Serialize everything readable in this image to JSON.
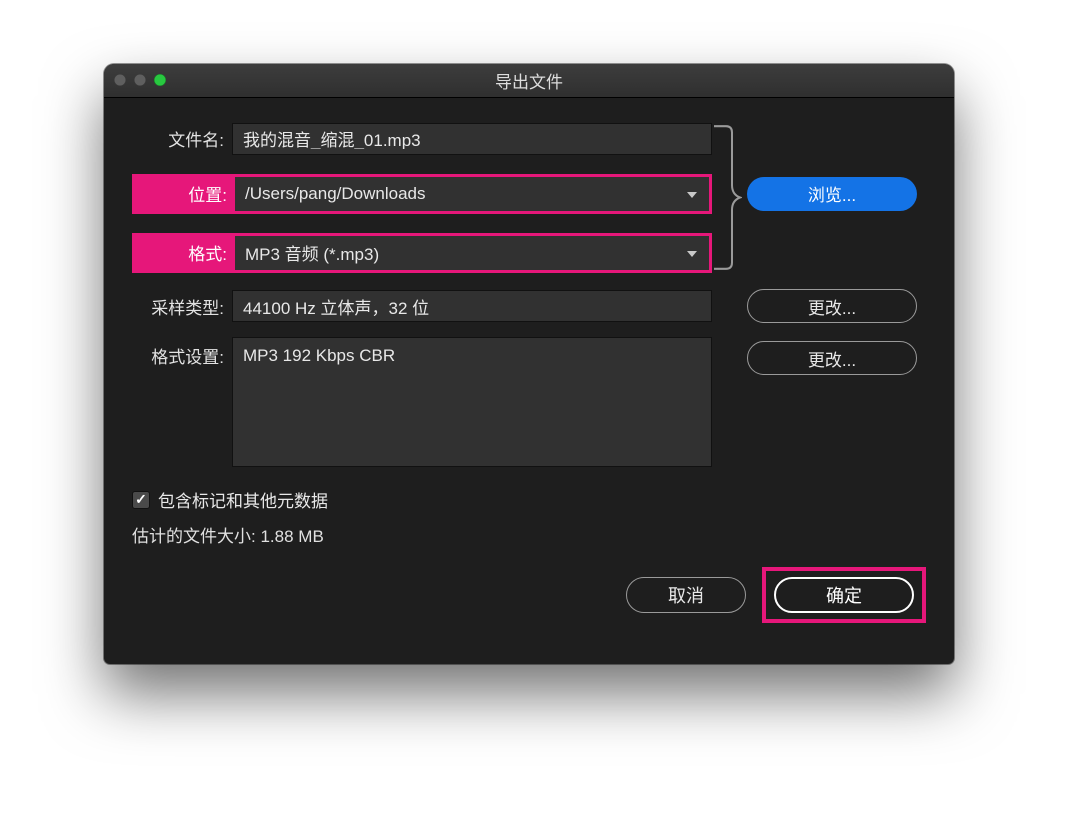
{
  "window": {
    "title": "导出文件"
  },
  "labels": {
    "filename": "文件名:",
    "location": "位置:",
    "format": "格式:",
    "sample_type": "采样类型:",
    "format_settings": "格式设置:"
  },
  "fields": {
    "filename": "我的混音_缩混_01.mp3",
    "location": "/Users/pang/Downloads",
    "format": "MP3 音频 (*.mp3)",
    "sample_type": "44100 Hz 立体声，32 位",
    "format_settings": "MP3 192 Kbps CBR"
  },
  "buttons": {
    "browse": "浏览...",
    "change1": "更改...",
    "change2": "更改...",
    "cancel": "取消",
    "ok": "确定"
  },
  "checkbox": {
    "label": "包含标记和其他元数据",
    "checked": true
  },
  "filesize": {
    "label": "估计的文件大小:",
    "value": "1.88 MB"
  }
}
